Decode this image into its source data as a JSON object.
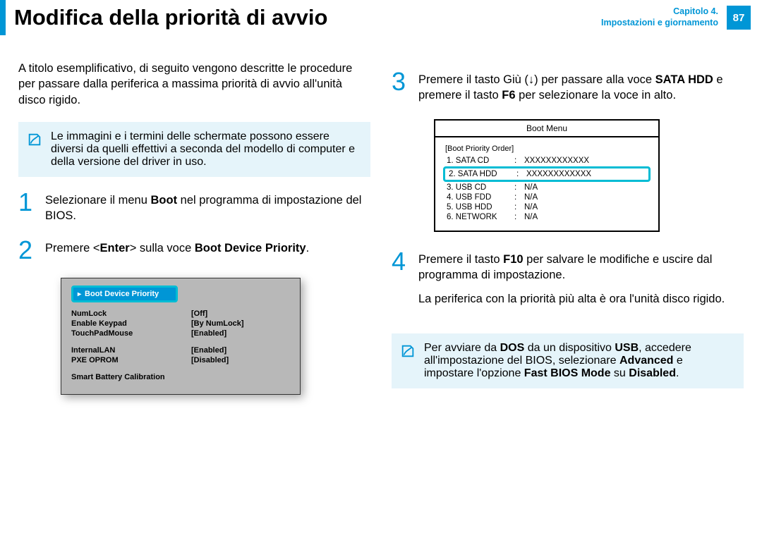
{
  "header": {
    "title": "Modifica della priorità di avvio",
    "chapter_line1": "Capitolo 4.",
    "chapter_line2": "Impostazioni e giornamento",
    "page_number": "87"
  },
  "intro": "A titolo esemplificativo, di seguito vengono descritte le procedure per passare dalla periferica a massima priorità di avvio all'unità disco rigido.",
  "note1": "Le immagini e i termini delle schermate possono essere diversi da quelli effettivi a seconda del modello di computer e della versione del driver in uso.",
  "steps": {
    "1": {
      "pre": "Selezionare il menu ",
      "b1": "Boot",
      "post": " nel programma di impostazione del BIOS."
    },
    "2": {
      "pre": "Premere <",
      "b1": "Enter",
      "mid": "> sulla voce ",
      "b2": "Boot Device Priority",
      "post": "."
    },
    "3": {
      "pre": "Premere il tasto Giù (↓) per passare alla voce ",
      "b1": "SATA HDD",
      "mid": " e premere il tasto ",
      "b2": "F6",
      "post": " per selezionare la voce in alto."
    },
    "4": {
      "pre": "Premere il tasto ",
      "b1": "F10",
      "post": " per salvare le modifiche e uscire dal programma di impostazione.",
      "extra": "La periferica con la priorità più alta è ora l'unità disco rigido."
    }
  },
  "note2": {
    "pre": "Per avviare da ",
    "b1": "DOS",
    "mid1": " da un dispositivo ",
    "b2": "USB",
    "mid2": ", accedere all'impostazione del BIOS, selezionare ",
    "b3": "Advanced",
    "mid3": " e impostare l'opzione ",
    "b4": "Fast BIOS Mode",
    "mid4": " su ",
    "b5": "Disabled",
    "post": "."
  },
  "bios1": {
    "highlight": "Boot Device Priority",
    "rows": [
      {
        "label": "NumLock",
        "value": "[Off]"
      },
      {
        "label": "Enable Keypad",
        "value": "[By NumLock]"
      },
      {
        "label": "TouchPadMouse",
        "value": "[Enabled]"
      }
    ],
    "rows2": [
      {
        "label": "InternalLAN",
        "value": "[Enabled]"
      },
      {
        "label": "PXE OPROM",
        "value": "[Disabled]"
      }
    ],
    "last": "Smart Battery Calibration"
  },
  "bios2": {
    "title": "Boot Menu",
    "legend": "[Boot Priority Order]",
    "rows": [
      {
        "n": "1. SATA CD",
        "v": "XXXXXXXXXXXX",
        "hl": false
      },
      {
        "n": "2. SATA HDD",
        "v": "XXXXXXXXXXXX",
        "hl": true
      },
      {
        "n": "3. USB CD",
        "v": "N/A",
        "hl": false
      },
      {
        "n": "4. USB FDD",
        "v": "N/A",
        "hl": false
      },
      {
        "n": "5. USB HDD",
        "v": "N/A",
        "hl": false
      },
      {
        "n": "6. NETWORK",
        "v": "N/A",
        "hl": false
      }
    ]
  }
}
